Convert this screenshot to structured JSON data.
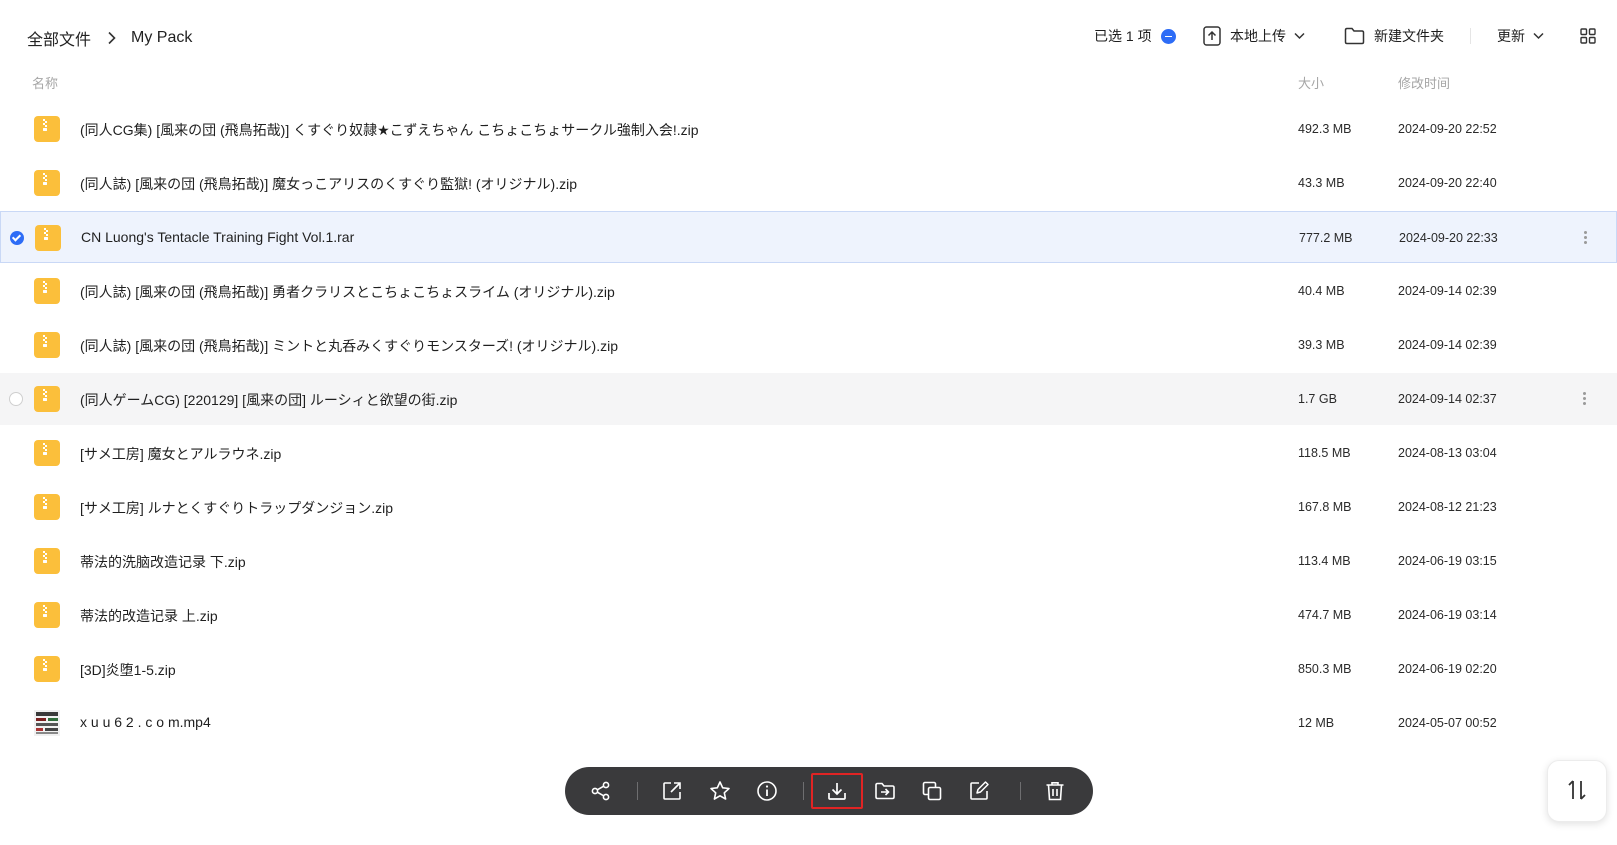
{
  "breadcrumb": {
    "root": "全部文件",
    "current": "My Pack"
  },
  "header": {
    "selected_label": "已选 1 项",
    "upload_label": "本地上传",
    "new_folder_label": "新建文件夹",
    "sort_label": "更新"
  },
  "columns": {
    "name": "名称",
    "size": "大小",
    "modified": "修改时间"
  },
  "colors": {
    "accent": "#2d6cf6",
    "folder": "#fbbf3b",
    "toolbar_bg": "#3a3a3c",
    "highlight": "#e02424"
  },
  "files": [
    {
      "name": "(同人CG集) [風来の団 (飛鳥拓哉)] くすぐり奴隷★こずえちゃん こちょこちょサークル強制入会!.zip",
      "size": "492.3 MB",
      "date": "2024-09-20 22:52",
      "icon": "archive-icon",
      "state": "normal"
    },
    {
      "name": "(同人誌) [風来の団 (飛鳥拓哉)] 魔女っこアリスのくすぐり監獄! (オリジナル).zip",
      "size": "43.3 MB",
      "date": "2024-09-20 22:40",
      "icon": "archive-icon",
      "state": "normal"
    },
    {
      "name": "CN Luong's Tentacle Training Fight Vol.1.rar",
      "size": "777.2 MB",
      "date": "2024-09-20 22:33",
      "icon": "archive-icon",
      "state": "selected"
    },
    {
      "name": "(同人誌) [風来の団 (飛鳥拓哉)] 勇者クラリスとこちょこちょスライム (オリジナル).zip",
      "size": "40.4 MB",
      "date": "2024-09-14 02:39",
      "icon": "archive-icon",
      "state": "normal"
    },
    {
      "name": "(同人誌) [風来の団 (飛鳥拓哉)] ミントと丸呑みくすぐりモンスターズ! (オリジナル).zip",
      "size": "39.3 MB",
      "date": "2024-09-14 02:39",
      "icon": "archive-icon",
      "state": "normal"
    },
    {
      "name": "(同人ゲームCG) [220129] [風来の団] ルーシィと欲望の街.zip",
      "size": "1.7 GB",
      "date": "2024-09-14 02:37",
      "icon": "archive-icon",
      "state": "hover"
    },
    {
      "name": "[サメ工房] 魔女とアルラウネ.zip",
      "size": "118.5 MB",
      "date": "2024-08-13 03:04",
      "icon": "archive-icon",
      "state": "normal"
    },
    {
      "name": "[サメ工房] ルナとくすぐりトラップダンジョン.zip",
      "size": "167.8 MB",
      "date": "2024-08-12 21:23",
      "icon": "archive-icon",
      "state": "normal"
    },
    {
      "name": "蒂法的洗脑改造记录 下.zip",
      "size": "113.4 MB",
      "date": "2024-06-19 03:15",
      "icon": "archive-icon",
      "state": "normal"
    },
    {
      "name": "蒂法的改造记录 上.zip",
      "size": "474.7 MB",
      "date": "2024-06-19 03:14",
      "icon": "archive-icon",
      "state": "normal"
    },
    {
      "name": "[3D]炎堕1-5.zip",
      "size": "850.3 MB",
      "date": "2024-06-19 02:20",
      "icon": "archive-icon",
      "state": "normal"
    },
    {
      "name": "x u u 6 2 . c o m.mp4",
      "size": "12 MB",
      "date": "2024-05-07 00:52",
      "icon": "video-thumbnail-icon",
      "state": "normal"
    }
  ],
  "toolbar": [
    "share-icon",
    "open-external-icon",
    "star-icon",
    "info-icon",
    "download-icon",
    "move-icon",
    "copy-icon",
    "rename-icon",
    "delete-icon"
  ]
}
